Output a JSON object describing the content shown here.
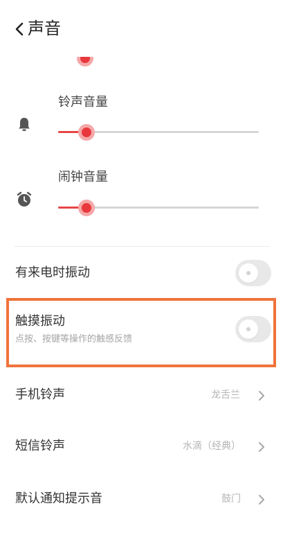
{
  "header": {
    "title": "声音"
  },
  "sliders": [
    {
      "label": "铃声音量",
      "icon": "bell-icon",
      "level": 0.14
    },
    {
      "label": "闹钟音量",
      "icon": "alarm-clock-icon",
      "level": 0.14
    }
  ],
  "settings": {
    "vibrate_on_call": {
      "label": "有来电时振动",
      "enabled": false
    },
    "haptic_feedback": {
      "label": "触摸振动",
      "sub": "点按、按键等操作的触感反馈",
      "enabled": false
    },
    "phone_ringtone": {
      "label": "手机铃声",
      "value": "龙舌兰"
    },
    "sms_ringtone": {
      "label": "短信铃声",
      "value": "水滴（经典）"
    },
    "notification_sound": {
      "label": "默认通知提示音",
      "value": "鼓门"
    }
  },
  "colors": {
    "accent": "#e8383d",
    "highlight": "#f0733a"
  }
}
